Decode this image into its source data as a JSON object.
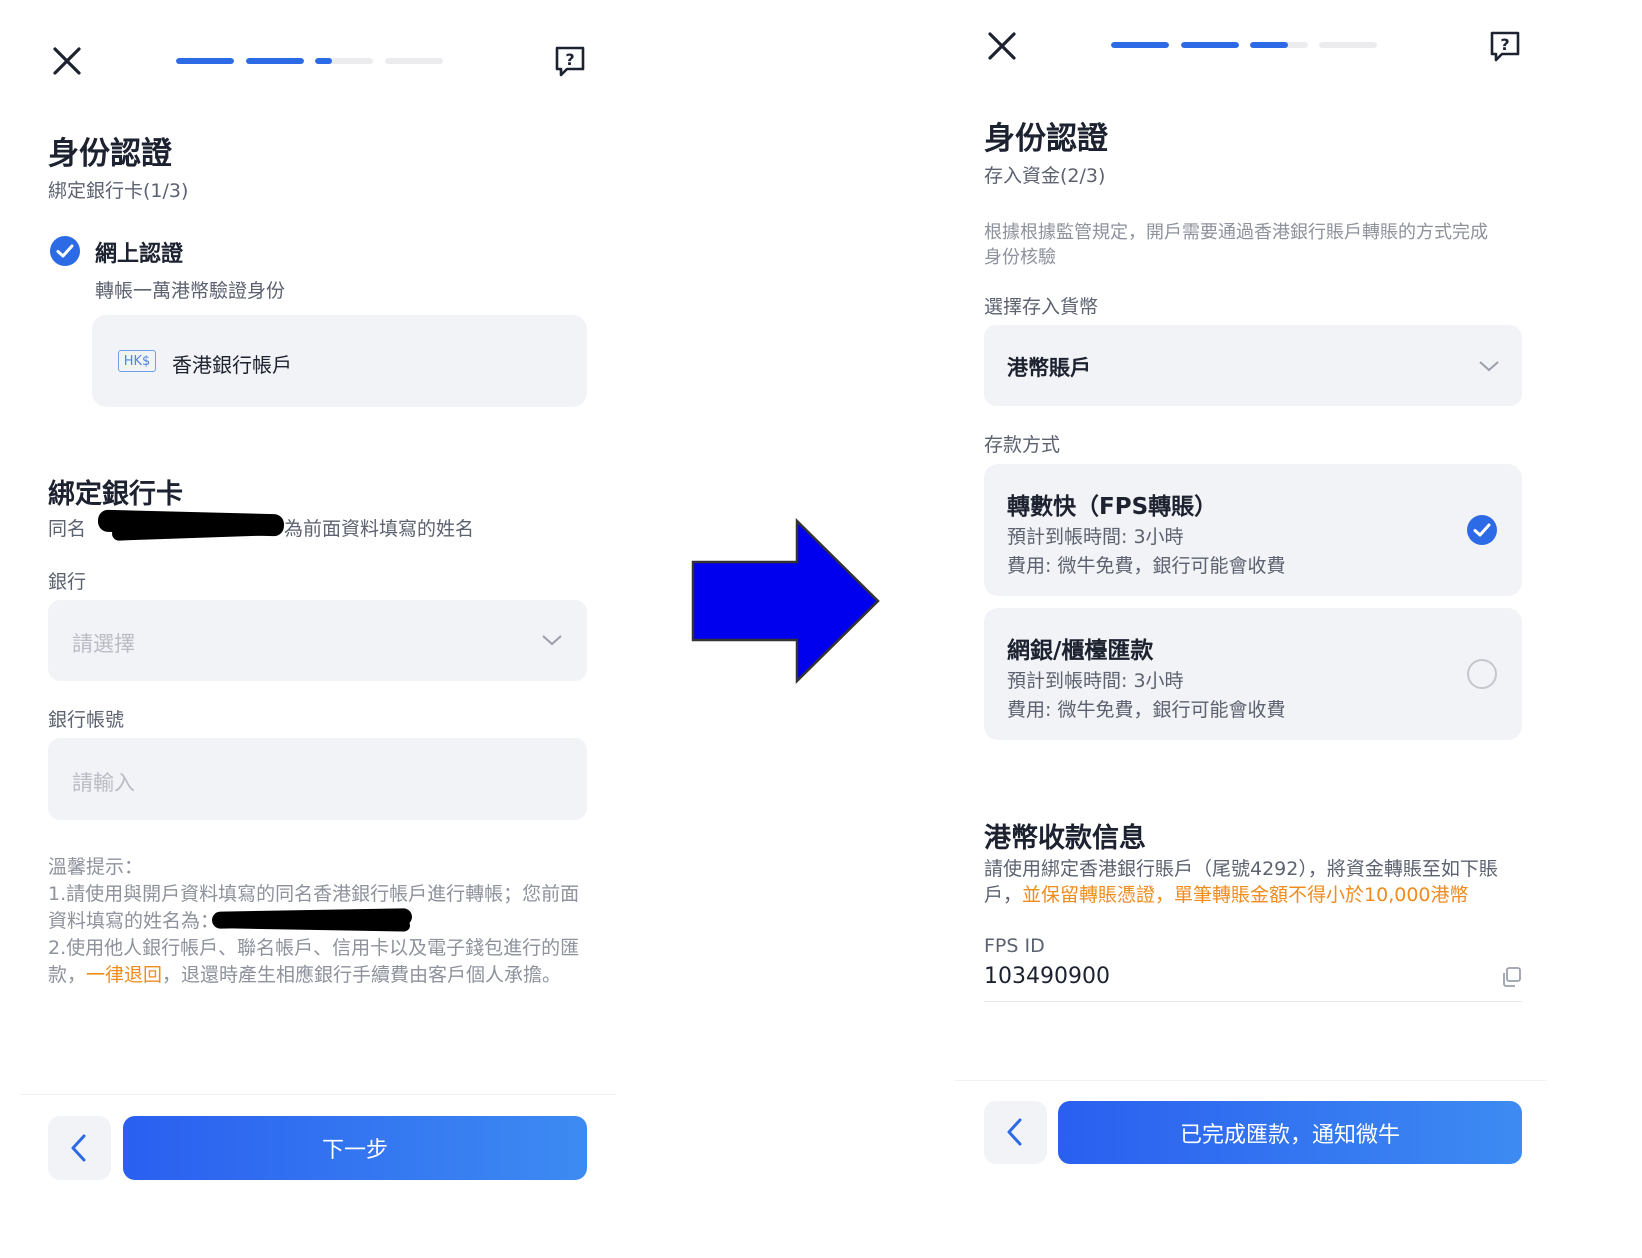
{
  "left": {
    "progress": [
      1,
      1,
      0.3,
      0
    ],
    "title": "身份認證",
    "subtitle": "綁定銀行卡(1/3)",
    "online_verify": {
      "label": "網上認證",
      "desc": "轉帳一萬港幣驗證身份",
      "badge": "HK$",
      "account_type": "香港銀行帳戶"
    },
    "bind_card": {
      "title": "綁定銀行卡",
      "same_name_prefix": "同名",
      "same_name_suffix": "為前面資料填寫的姓名"
    },
    "bank": {
      "label": "銀行",
      "placeholder": "請選擇"
    },
    "account_no": {
      "label": "銀行帳號",
      "placeholder": "請輸入"
    },
    "tips": {
      "heading": "溫馨提示：",
      "line1": "1.請使用與開戶資料填寫的同名香港銀行帳戶進行轉帳；您前面",
      "line2": "資料填寫的姓名為：",
      "line3": "2.使用他人銀行帳戶、聯名帳戶、信用卡以及電子錢包進行的匯",
      "line4_pre": "款，",
      "line4_warn": "一律退回",
      "line4_post": "，退還時產生相應銀行手續費由客戶個人承擔。"
    },
    "next_button": "下一步"
  },
  "right": {
    "progress": [
      1,
      1,
      0.65,
      0
    ],
    "title": "身份認證",
    "subtitle": "存入資金(2/3)",
    "notice_line1": "根據根據監管規定，開戶需要通過香港銀行賬戶轉賬的方式完成",
    "notice_line2": "身份核驗",
    "currency": {
      "label": "選擇存入貨幣",
      "value": "港幣賬戶"
    },
    "method_label": "存款方式",
    "methods": [
      {
        "title": "轉數快（FPS轉賬）",
        "eta": "預計到帳時間: 3小時",
        "fee": "費用: 微牛免費，銀行可能會收費",
        "selected": true
      },
      {
        "title": "網銀/櫃檯匯款",
        "eta": "預計到帳時間: 3小時",
        "fee": "費用: 微牛免費，銀行可能會收費",
        "selected": false
      }
    ],
    "receive": {
      "title": "港幣收款信息",
      "line1": "請使用綁定香港銀行賬戶（尾號4292），將資金轉賬至如下賬",
      "line2_pre": "戶，",
      "line2_warn": "並保留轉賬憑證，單筆轉賬金額不得小於10,000港幣",
      "fps_label": "FPS ID",
      "fps_value": "103490900"
    },
    "done_button": "已完成匯款，通知微牛"
  },
  "colors": {
    "accent": "#2d6be6",
    "warning": "#f08c1e",
    "arrow": "#0000ee"
  }
}
